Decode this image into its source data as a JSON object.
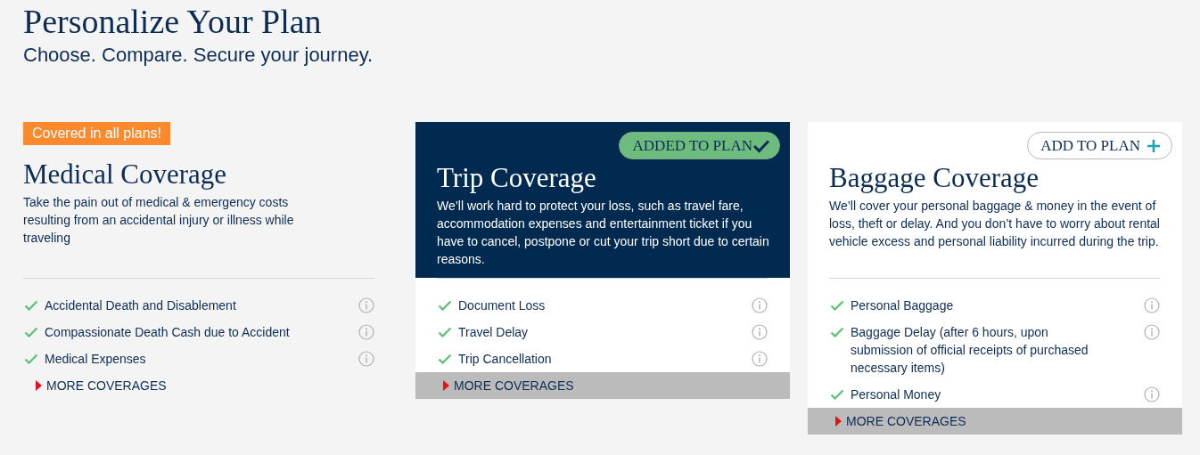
{
  "header": {
    "title": "Personalize Your Plan",
    "subtitle": "Choose. Compare. Secure your journey."
  },
  "plans": [
    {
      "kind": "included",
      "badge": "Covered in all plans!",
      "title": "Medical Coverage",
      "description": "Take the pain out of medical & emergency costs resulting from an accidental injury or illness while traveling",
      "coverages": [
        "Accidental Death and Disablement",
        "Compassionate Death Cash due to Accident",
        "Medical Expenses"
      ],
      "more": "MORE COVERAGES"
    },
    {
      "kind": "optional",
      "added": true,
      "button": "ADDED TO PLAN",
      "title": "Trip Coverage",
      "description": "We’ll work hard to protect your loss, such as travel fare, accommodation expenses and entertainment ticket if you have to cancel, postpone or cut your trip short due to certain reasons.",
      "coverages": [
        "Document Loss",
        "Travel Delay",
        "Trip Cancellation"
      ],
      "more": "MORE COVERAGES"
    },
    {
      "kind": "optional",
      "added": false,
      "button": "ADD TO PLAN",
      "title": "Baggage Coverage",
      "description": "We’ll cover your personal baggage & money in the event of loss, theft or delay. And you don’t have to worry about rental vehicle excess and personal liability incurred during the trip.",
      "coverages": [
        "Personal Baggage",
        "Baggage Delay (after 6 hours, upon submission of official receipts of purchased necessary items)",
        "Personal Money"
      ],
      "more": "MORE COVERAGES"
    }
  ]
}
